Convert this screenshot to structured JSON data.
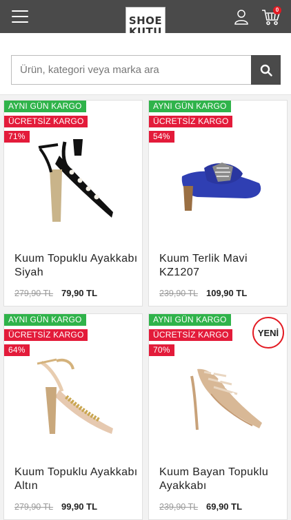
{
  "header": {
    "logo_line1": "SHOE",
    "logo_line2": "KUTU",
    "cart_count": "0"
  },
  "search": {
    "placeholder": "Ürün, kategori veya marka ara"
  },
  "products": [
    {
      "badge_shipping": "AYNI GÜN KARGO",
      "badge_free": "ÜCRETSİZ KARGO",
      "discount": "71%",
      "name": "Kuum Topuklu Ayakkabı Siyah",
      "old_price": "279,90 TL",
      "price": "79,90 TL"
    },
    {
      "badge_shipping": "AYNI GÜN KARGO",
      "badge_free": "ÜCRETSİZ KARGO",
      "discount": "54%",
      "name": "Kuum Terlik Mavi KZ1207",
      "old_price": "239,90 TL",
      "price": "109,90 TL"
    },
    {
      "badge_shipping": "AYNI GÜN KARGO",
      "badge_free": "ÜCRETSİZ KARGO",
      "discount": "64%",
      "name": "Kuum Topuklu Ayakkabı Altın",
      "old_price": "279,90 TL",
      "price": "99,90 TL"
    },
    {
      "badge_shipping": "AYNI GÜN KARGO",
      "badge_free": "ÜCRETSİZ KARGO",
      "discount": "70%",
      "new_label": "YENİ",
      "name": "Kuum Bayan Topuklu Ayakkabı",
      "old_price": "239,90 TL",
      "price": "69,90 TL"
    }
  ],
  "icons": [
    "menu-icon",
    "user-icon",
    "cart-icon",
    "search-icon"
  ]
}
